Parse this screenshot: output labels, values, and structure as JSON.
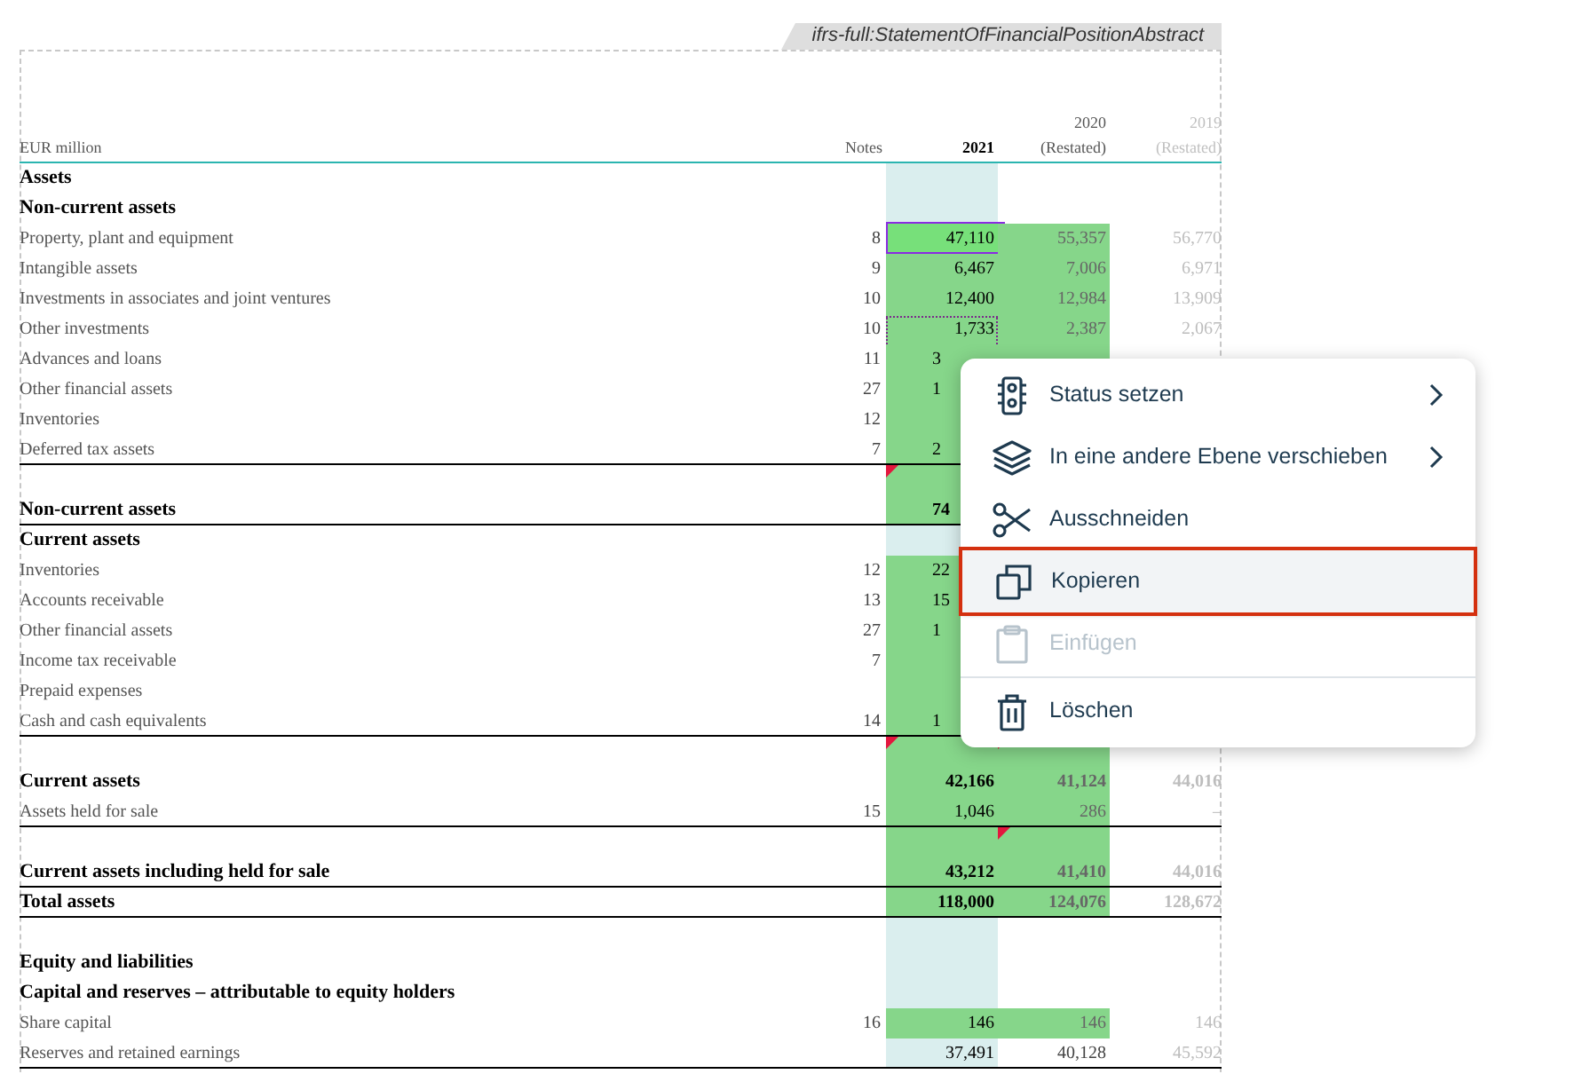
{
  "tag": "ifrs-full:StatementOfFinancialPositionAbstract",
  "header": {
    "label": "EUR million",
    "notes": "Notes",
    "year_2021": "2021",
    "year_2020": "2020",
    "note_2020": "(Restated)",
    "year_2019": "2019",
    "note_2019": "(Restated)"
  },
  "rows": [
    {
      "label": "Assets",
      "bold": true,
      "rule": false,
      "c2021": {
        "tagged": false,
        "flagged": false,
        "selected": false,
        "outlined": false
      },
      "c2020": {
        "tagged": false,
        "flagged": false
      }
    },
    {
      "label": "Non-current assets",
      "bold": true,
      "rule": false,
      "c2021": {
        "tagged": false,
        "flagged": false,
        "selected": false,
        "outlined": false
      },
      "c2020": {
        "tagged": false,
        "flagged": false
      }
    },
    {
      "label": "Property, plant and equipment",
      "bold": false,
      "rule": false,
      "notes": "8",
      "c2021": {
        "text": "47,110",
        "clipped": false,
        "tagged": true,
        "flagged": false,
        "selected": true,
        "outlined": false
      },
      "c2020": {
        "text": "55,357",
        "tagged": true,
        "flagged": false
      },
      "c2019": "56,770"
    },
    {
      "label": "Intangible assets",
      "bold": false,
      "rule": false,
      "notes": "9",
      "c2021": {
        "text": "6,467",
        "clipped": false,
        "tagged": true,
        "flagged": false,
        "selected": false,
        "outlined": false
      },
      "c2020": {
        "text": "7,006",
        "tagged": true,
        "flagged": false
      },
      "c2019": "6,971"
    },
    {
      "label": "Investments in associates and joint ventures",
      "bold": false,
      "rule": false,
      "notes": "10",
      "c2021": {
        "text": "12,400",
        "clipped": false,
        "tagged": true,
        "flagged": false,
        "selected": false,
        "outlined": false
      },
      "c2020": {
        "text": "12,984",
        "tagged": true,
        "flagged": false
      },
      "c2019": "13,909"
    },
    {
      "label": "Other investments",
      "bold": false,
      "rule": false,
      "notes": "10",
      "c2021": {
        "text": "1,733",
        "clipped": false,
        "tagged": true,
        "flagged": false,
        "selected": false,
        "outlined": true
      },
      "c2020": {
        "text": "2,387",
        "tagged": true,
        "flagged": false
      },
      "c2019": "2,067"
    },
    {
      "label": "Advances and loans",
      "bold": false,
      "rule": false,
      "notes": "11",
      "c2021": {
        "text": "3",
        "clipped": true,
        "tagged": true,
        "flagged": false,
        "selected": false,
        "outlined": false
      },
      "c2020": {
        "tagged": true,
        "flagged": false
      }
    },
    {
      "label": "Other financial assets",
      "bold": false,
      "rule": false,
      "notes": "27",
      "c2021": {
        "text": "1",
        "clipped": true,
        "tagged": true,
        "flagged": false,
        "outlined": false
      }
    },
    {
      "label": "Inventories",
      "bold": false,
      "rule": false,
      "notes": "12",
      "c2021": {
        "tagged": true,
        "flagged": false,
        "outlined": false
      }
    },
    {
      "label": "Deferred tax assets",
      "bold": false,
      "rule": true,
      "notes": "7",
      "c2021": {
        "text": "2",
        "clipped": true,
        "tagged": true,
        "flagged": false,
        "outlined": false
      }
    },
    {
      "rule": false,
      "c2021": {
        "tagged": true,
        "flagged": true
      }
    },
    {
      "label": "Non-current assets",
      "bold": true,
      "rule": true,
      "c2021": {
        "text": "74",
        "clipped": true,
        "tagged": true,
        "flagged": false,
        "outlined": false
      }
    },
    {
      "label": "Current assets",
      "bold": true,
      "rule": false,
      "c2021": {
        "tagged": false,
        "flagged": false,
        "outlined": false
      }
    },
    {
      "label": "Inventories",
      "bold": false,
      "rule": false,
      "notes": "12",
      "c2021": {
        "text": "22",
        "clipped": true,
        "tagged": true,
        "flagged": false,
        "outlined": false
      }
    },
    {
      "label": "Accounts receivable",
      "bold": false,
      "rule": false,
      "notes": "13",
      "c2021": {
        "text": "15",
        "clipped": true,
        "tagged": true,
        "flagged": false,
        "outlined": false
      }
    },
    {
      "label": "Other financial assets",
      "bold": false,
      "rule": false,
      "notes": "27",
      "c2021": {
        "text": "1",
        "clipped": true,
        "tagged": true,
        "flagged": false,
        "outlined": false
      }
    },
    {
      "label": "Income tax receivable",
      "bold": false,
      "rule": false,
      "notes": "7",
      "c2021": {
        "tagged": true,
        "flagged": false,
        "outlined": false
      }
    },
    {
      "label": "Prepaid expenses",
      "bold": false,
      "rule": false,
      "c2021": {
        "tagged": true,
        "flagged": false,
        "outlined": false
      }
    },
    {
      "label": "Cash and cash equivalents",
      "bold": false,
      "rule": true,
      "notes": "14",
      "c2021": {
        "text": "1",
        "clipped": true,
        "tagged": true,
        "flagged": false,
        "outlined": false
      }
    },
    {
      "rule": false,
      "c2021": {
        "tagged": true,
        "flagged": true,
        "selected": false
      },
      "c2020": {
        "tagged": true,
        "flagged": true
      }
    },
    {
      "label": "Current assets",
      "bold": true,
      "rule": false,
      "c2021": {
        "text": "42,166",
        "clipped": false,
        "tagged": true,
        "flagged": false,
        "selected": false,
        "outlined": false
      },
      "c2020": {
        "text": "41,124",
        "tagged": true,
        "flagged": false
      },
      "c2019": "44,016"
    },
    {
      "label": "Assets held for sale",
      "bold": false,
      "rule": true,
      "notes": "15",
      "c2021": {
        "text": "1,046",
        "clipped": false,
        "tagged": true,
        "flagged": false,
        "selected": false,
        "outlined": false
      },
      "c2020": {
        "text": "286",
        "tagged": true,
        "flagged": false
      },
      "c2019": "–"
    },
    {
      "rule": false,
      "c2021": {
        "tagged": true,
        "flagged": false,
        "selected": false
      },
      "c2020": {
        "tagged": true,
        "flagged": true
      }
    },
    {
      "label": "Current assets including held for sale",
      "bold": true,
      "rule": true,
      "c2021": {
        "text": "43,212",
        "clipped": false,
        "tagged": true,
        "flagged": false,
        "selected": false,
        "outlined": false
      },
      "c2020": {
        "text": "41,410",
        "tagged": true,
        "flagged": false
      },
      "c2019": "44,016"
    },
    {
      "label": "Total assets",
      "bold": true,
      "rule": true,
      "c2021": {
        "text": "118,000",
        "clipped": false,
        "tagged": true,
        "flagged": false,
        "selected": false,
        "outlined": false
      },
      "c2020": {
        "text": "124,076",
        "tagged": true,
        "flagged": false
      },
      "c2019": "128,672"
    },
    {
      "rule": false,
      "c2021": {
        "tagged": false,
        "flagged": false,
        "selected": false
      },
      "c2020": {
        "tagged": false,
        "flagged": false
      }
    },
    {
      "label": "Equity and liabilities",
      "bold": true,
      "rule": false,
      "c2021": {
        "tagged": false,
        "flagged": false,
        "selected": false,
        "outlined": false
      },
      "c2020": {
        "tagged": false,
        "flagged": false
      }
    },
    {
      "label": "Capital and reserves – attributable to equity holders",
      "bold": true,
      "rule": false,
      "c2021": {
        "tagged": false,
        "flagged": false,
        "selected": false,
        "outlined": false
      },
      "c2020": {
        "tagged": false,
        "flagged": false
      }
    },
    {
      "label": "Share capital",
      "bold": false,
      "rule": false,
      "notes": "16",
      "c2021": {
        "text": "146",
        "clipped": false,
        "tagged": true,
        "flagged": false,
        "selected": false,
        "outlined": false
      },
      "c2020": {
        "text": "146",
        "tagged": true,
        "flagged": false
      },
      "c2019": "146"
    },
    {
      "label": "Reserves and retained earnings",
      "bold": false,
      "rule": true,
      "c2021": {
        "text": "37,491",
        "clipped": false,
        "tagged": false,
        "flagged": false,
        "selected": false,
        "outlined": false
      },
      "c2020": {
        "text": "40,128",
        "tagged": false,
        "flagged": false
      },
      "c2019": "45,592"
    }
  ],
  "context_menu": {
    "items": [
      {
        "label": "Status setzen",
        "kind": "submenu",
        "selected": false,
        "disabled": false
      },
      {
        "label": "In eine andere Ebene verschieben",
        "kind": "submenu",
        "selected": false,
        "disabled": false
      },
      {
        "label": "Ausschneiden",
        "kind": "action",
        "selected": false,
        "disabled": false
      },
      {
        "label": "Kopieren",
        "kind": "action",
        "selected": true,
        "disabled": false
      },
      {
        "label": "Einfügen",
        "kind": "action",
        "selected": false,
        "disabled": true
      },
      {
        "label": "Löschen",
        "kind": "separated",
        "selected": false,
        "disabled": false
      }
    ]
  }
}
